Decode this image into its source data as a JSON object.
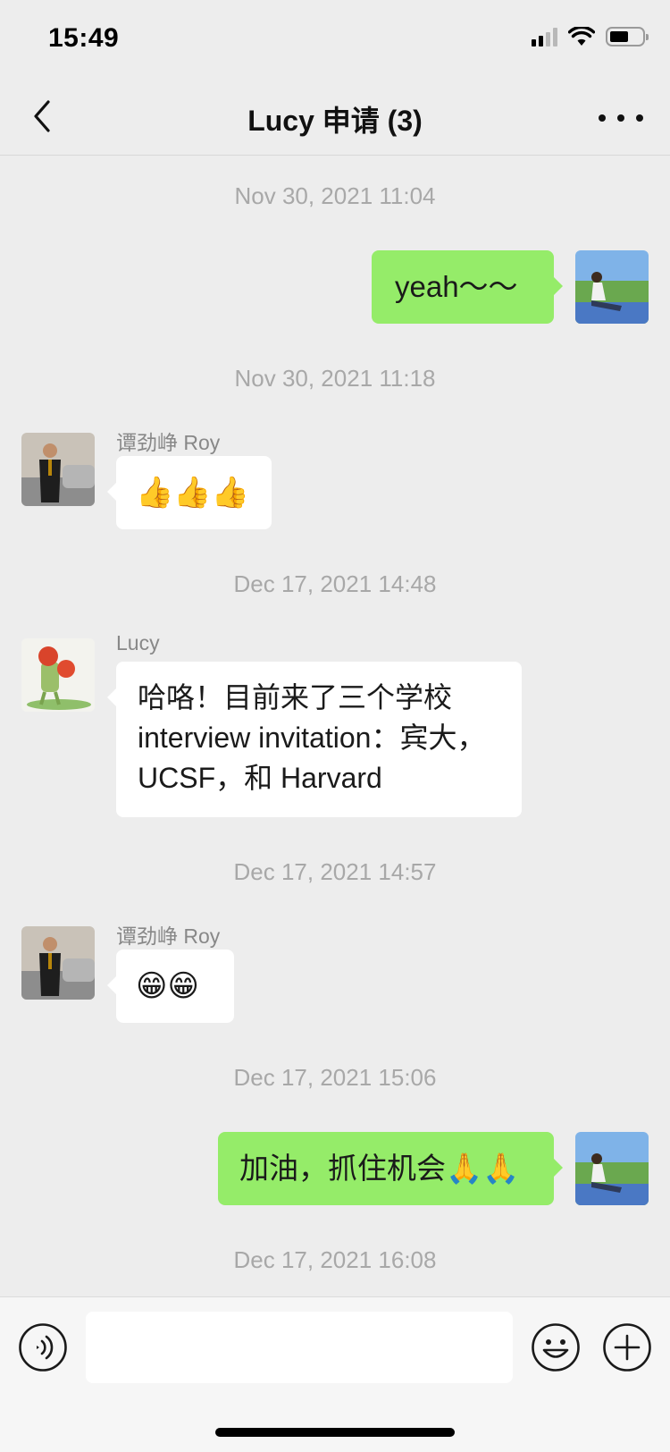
{
  "status_bar": {
    "time": "15:49",
    "battery_level": 0.55
  },
  "nav": {
    "title": "Lucy 申请 (3)"
  },
  "chat": {
    "timestamps": [
      "Nov 30, 2021 11:04",
      "Nov 30, 2021 11:18",
      "Dec 17, 2021 14:48",
      "Dec 17, 2021 14:57",
      "Dec 17, 2021 15:06",
      "Dec 17, 2021 16:08"
    ],
    "messages": [
      {
        "direction": "out",
        "text": "yeah～～"
      },
      {
        "direction": "in",
        "sender": "谭劲峥 Roy",
        "text": "👍👍👍"
      },
      {
        "direction": "in",
        "sender": "Lucy",
        "text": "哈咯！目前来了三个学校interview invitation：宾大，UCSF，和 Harvard"
      },
      {
        "direction": "in",
        "sender": "谭劲峥 Roy",
        "text": "😁😁"
      },
      {
        "direction": "out",
        "text": "加油，抓住机会🙏🙏"
      }
    ]
  },
  "input_bar": {
    "value": "",
    "placeholder": ""
  },
  "icons": {
    "back": "chevron-left-icon",
    "more": "more-dots-icon",
    "voice": "voice-icon",
    "emoji": "emoji-face-icon",
    "plus": "plus-icon"
  },
  "colors": {
    "background": "#ededed",
    "outgoing_bubble": "#95ec69",
    "incoming_bubble": "#ffffff",
    "timestamp": "#a8a8a8"
  }
}
